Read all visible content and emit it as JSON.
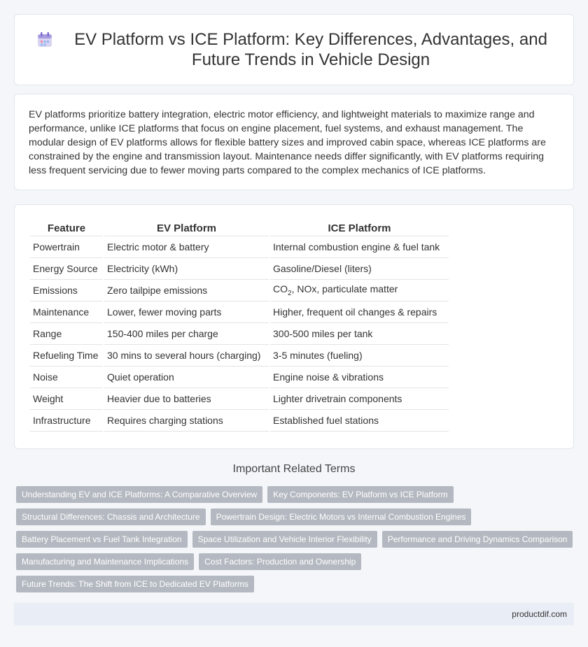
{
  "header": {
    "title": "EV Platform vs ICE Platform: Key Differences, Advantages, and Future Trends in Vehicle Design",
    "icon": "calendar-icon"
  },
  "intro": {
    "text": "EV platforms prioritize battery integration, electric motor efficiency, and lightweight materials to maximize range and performance, unlike ICE platforms that focus on engine placement, fuel systems, and exhaust management. The modular design of EV platforms allows for flexible battery sizes and improved cabin space, whereas ICE platforms are constrained by the engine and transmission layout. Maintenance needs differ significantly, with EV platforms requiring less frequent servicing due to fewer moving parts compared to the complex mechanics of ICE platforms."
  },
  "table": {
    "headers": [
      "Feature",
      "EV Platform",
      "ICE Platform"
    ],
    "rows": [
      [
        "Powertrain",
        "Electric motor & battery",
        "Internal combustion engine & fuel tank"
      ],
      [
        "Energy Source",
        "Electricity (kWh)",
        "Gasoline/Diesel (liters)"
      ],
      [
        "Emissions",
        "Zero tailpipe emissions",
        "CO",
        "2",
        ", NOx, particulate matter"
      ],
      [
        "Maintenance",
        "Lower, fewer moving parts",
        "Higher, frequent oil changes & repairs"
      ],
      [
        "Range",
        "150-400 miles per charge",
        "300-500 miles per tank"
      ],
      [
        "Refueling Time",
        "30 mins to several hours (charging)",
        "3-5 minutes (fueling)"
      ],
      [
        "Noise",
        "Quiet operation",
        "Engine noise & vibrations"
      ],
      [
        "Weight",
        "Heavier due to batteries",
        "Lighter drivetrain components"
      ],
      [
        "Infrastructure",
        "Requires charging stations",
        "Established fuel stations"
      ]
    ]
  },
  "related": {
    "title": "Important Related Terms",
    "tags": [
      [
        "Understanding EV and ICE Platforms: A Comparative Overview",
        "Key Components: EV Platform vs ICE Platform"
      ],
      [
        "Structural Differences: Chassis and Architecture",
        "Powertrain Design: Electric Motors vs Internal Combustion Engines"
      ],
      [
        "Battery Placement vs Fuel Tank Integration",
        "Space Utilization and Vehicle Interior Flexibility",
        "Performance and Driving Dynamics Comparison"
      ],
      [
        "Manufacturing and Maintenance Implications",
        "Cost Factors: Production and Ownership"
      ],
      [
        "Future Trends: The Shift from ICE to Dedicated EV Platforms"
      ]
    ]
  },
  "footer": {
    "site": "productdif.com"
  }
}
